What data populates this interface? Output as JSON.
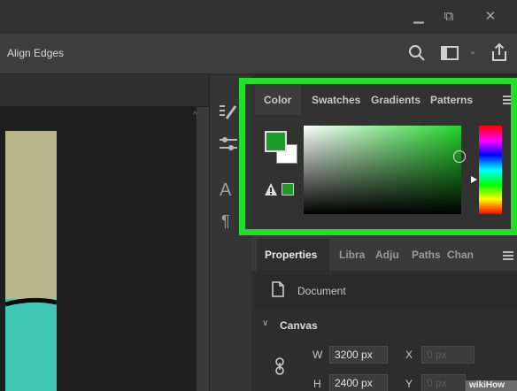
{
  "window": {
    "minimize": "▁",
    "restore": "⧉",
    "close": "✕"
  },
  "options_bar": {
    "align_edges": "Align Edges"
  },
  "color_panel": {
    "tabs": [
      "Color",
      "Swatches",
      "Gradients",
      "Patterns"
    ],
    "foreground_color": "#1d9a2a",
    "background_color": "#ffffff",
    "web_safe_color": "#1d9a2a",
    "highlight_color": "#22e02a"
  },
  "properties_panel": {
    "tabs": [
      "Properties",
      "Libra",
      "Adju",
      "Paths",
      "Chan"
    ],
    "document_label": "Document",
    "canvas_label": "Canvas",
    "w_label": "W",
    "w_value": "3200 px",
    "h_label": "H",
    "h_value": "2400 px",
    "x_label": "X",
    "x_value": "0 px",
    "y_label": "Y",
    "y_value": "0 px"
  },
  "watermark": "wikiHow"
}
